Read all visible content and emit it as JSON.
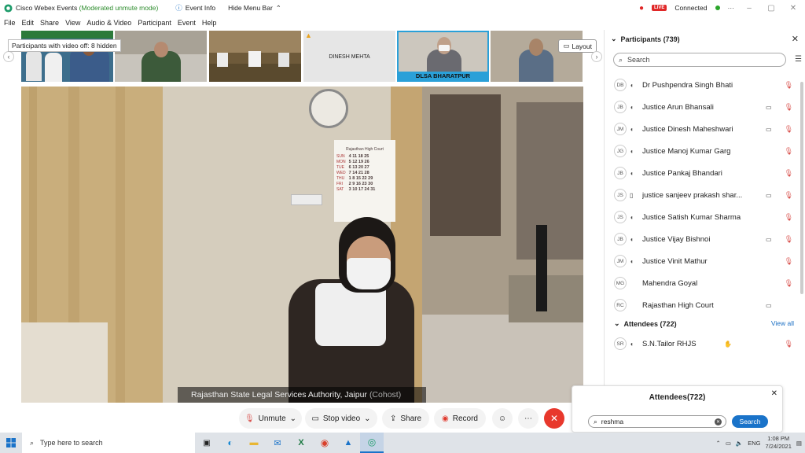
{
  "window": {
    "title": "Cisco Webex Events",
    "mode": "(Moderated unmute mode)",
    "event_info": "Event Info",
    "hide_menu": "Hide Menu Bar",
    "live": "LIVE",
    "status": "Connected"
  },
  "menu": [
    "File",
    "Edit",
    "Share",
    "View",
    "Audio & Video",
    "Participant",
    "Event",
    "Help"
  ],
  "strip": {
    "video_off_tip": "Participants with video off: 8 hidden",
    "layout_label": "Layout",
    "thumbs": [
      {
        "label": ""
      },
      {
        "label": ""
      },
      {
        "label": ""
      },
      {
        "label": "DINESH MEHTA"
      },
      {
        "label": "DLSA BHARATPUR"
      },
      {
        "label": ""
      }
    ]
  },
  "main": {
    "speaker": "Rajasthan State Legal Services Authority, Jaipur",
    "cohost": "(Cohost)"
  },
  "controls": {
    "unmute": "Unmute",
    "stop_video": "Stop video",
    "share": "Share",
    "record": "Record"
  },
  "panel": {
    "title": "Participants (739)",
    "search_placeholder": "Search",
    "participants": [
      {
        "initials": "DB",
        "name": "Dr Pushpendra Singh Bhati",
        "cam": false
      },
      {
        "initials": "JB",
        "name": "Justice Arun Bhansali",
        "cam": true
      },
      {
        "initials": "JM",
        "name": "Justice Dinesh Maheshwari",
        "cam": true
      },
      {
        "initials": "JG",
        "name": "Justice Manoj Kumar Garg",
        "cam": false
      },
      {
        "initials": "JB",
        "name": "Justice Pankaj Bhandari",
        "cam": false
      },
      {
        "initials": "JS",
        "name": "justice sanjeev prakash shar...",
        "cam": true
      },
      {
        "initials": "JS",
        "name": "Justice Satish Kumar Sharma",
        "cam": false
      },
      {
        "initials": "JB",
        "name": "Justice Vijay Bishnoi",
        "cam": true
      },
      {
        "initials": "JM",
        "name": "Justice Vinit Mathur",
        "cam": false
      },
      {
        "initials": "MG",
        "name": "Mahendra Goyal",
        "cam": false
      },
      {
        "initials": "RC",
        "name": "Rajasthan High Court",
        "cam": true
      }
    ],
    "attendees_title": "Attendees (722)",
    "view_all": "View all",
    "attendees": [
      {
        "initials": "SR",
        "name": "S.N.Tailor RHJS"
      }
    ]
  },
  "popup": {
    "title": "Attendees(722)",
    "search_value": "reshma",
    "search_button": "Search"
  },
  "taskbar": {
    "search_placeholder": "Type here to search",
    "lang": "ENG",
    "time": "1:08 PM",
    "date": "7/24/2021"
  },
  "calendar": {
    "court": "Rajasthan High Court",
    "days": [
      "SUN",
      "MON",
      "TUE",
      "WED",
      "THU",
      "FRI",
      "SAT"
    ],
    "rows": [
      "4 11 18 25",
      "5 12 19 26",
      "6 13 20 27",
      "7 14 21 28",
      "1 8 15 22 29",
      "2 9 16 23 30",
      "3 10 17 24 31"
    ]
  }
}
